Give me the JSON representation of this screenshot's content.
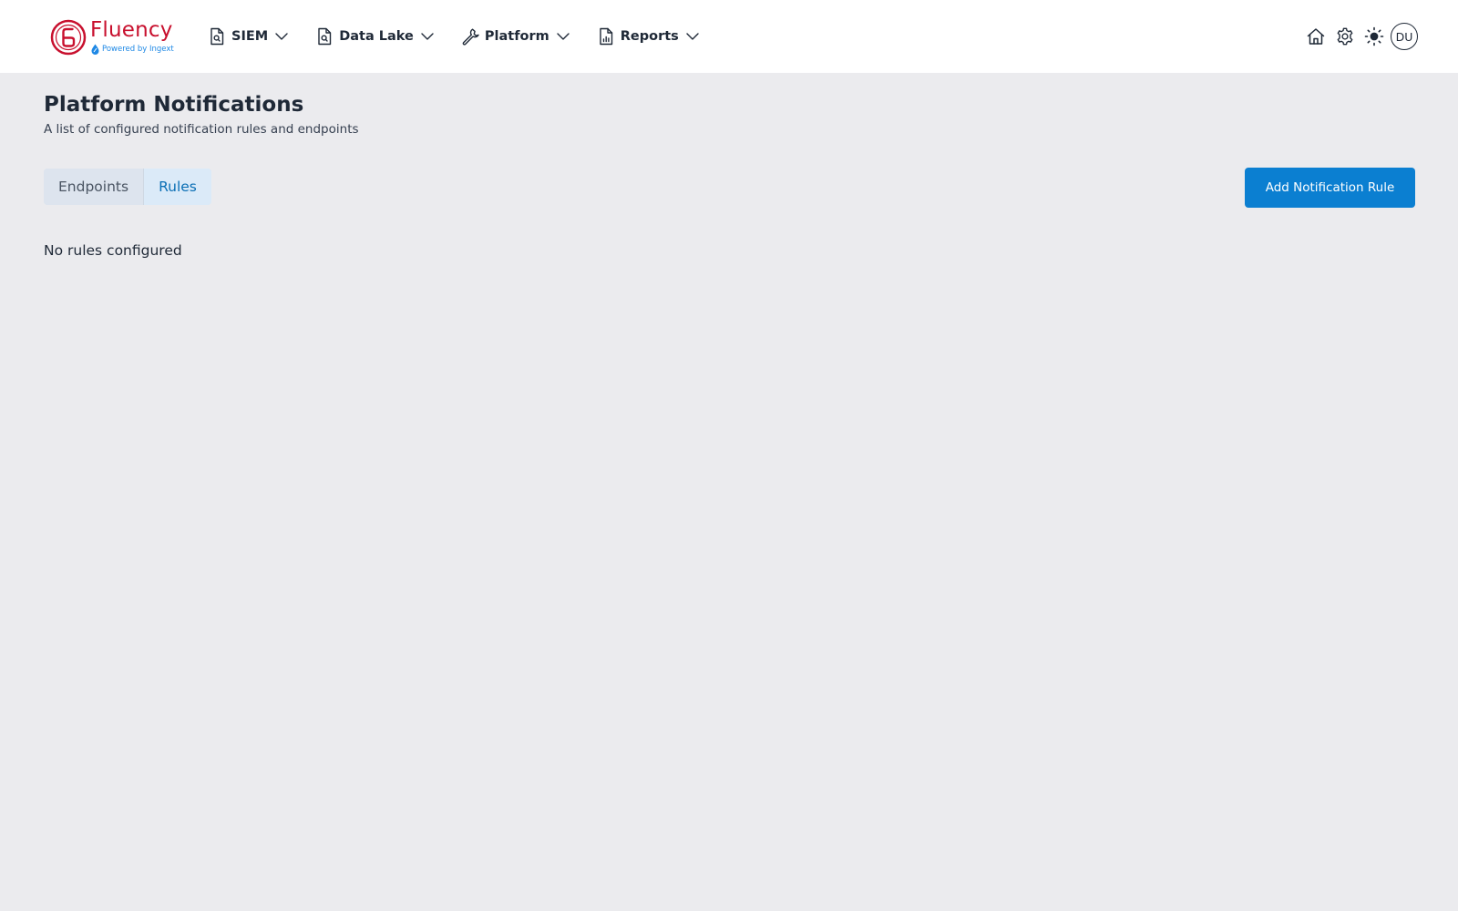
{
  "brand": {
    "name": "Fluency",
    "tagline": "Powered by Ingext",
    "primary_color": "#c8102e",
    "accent_color": "#1e88e5"
  },
  "nav": {
    "items": [
      {
        "label": "SIEM",
        "icon": "document-search-icon"
      },
      {
        "label": "Data Lake",
        "icon": "document-search-icon"
      },
      {
        "label": "Platform",
        "icon": "wrench-icon"
      },
      {
        "label": "Reports",
        "icon": "document-chart-icon"
      }
    ]
  },
  "tools": {
    "home_icon": "home-icon",
    "settings_icon": "gear-icon",
    "theme_icon": "sun-icon",
    "avatar_initials": "DU"
  },
  "page": {
    "title": "Platform Notifications",
    "subtitle": "A list of configured notification rules and endpoints"
  },
  "tabs": {
    "items": [
      {
        "label": "Endpoints",
        "active": false
      },
      {
        "label": "Rules",
        "active": true
      }
    ]
  },
  "actions": {
    "add_label": "Add Notification Rule",
    "button_color": "#0b7fd1"
  },
  "content": {
    "empty_message": "No rules configured"
  }
}
